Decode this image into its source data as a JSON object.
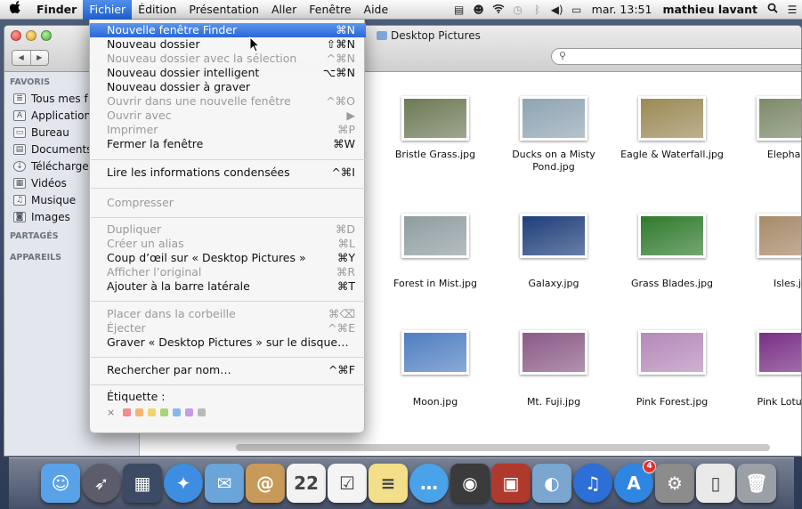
{
  "menubar": {
    "apple_icon": "apple-logo",
    "items": [
      "Finder",
      "Fichier",
      "Édition",
      "Présentation",
      "Aller",
      "Fenêtre",
      "Aide"
    ],
    "active_index": 1,
    "status_icons": [
      "script-icon",
      "finder-extra-icon",
      "wifi-icon",
      "time-machine-icon",
      "bluetooth-icon",
      "volume-icon",
      "battery-icon"
    ],
    "clock": "mar. 13:51",
    "user": "mathieu lavant",
    "spotlight_icon": "magnifier-icon"
  },
  "window": {
    "title": "Desktop Pictures",
    "search_placeholder": ""
  },
  "sidebar": {
    "favorites_header": "FAVORIS",
    "favorites": [
      {
        "label": "Tous mes f",
        "icon": "all-files-icon"
      },
      {
        "label": "Application",
        "icon": "applications-icon"
      },
      {
        "label": "Bureau",
        "icon": "desktop-icon"
      },
      {
        "label": "Documents",
        "icon": "documents-icon"
      },
      {
        "label": "Télécharge",
        "icon": "downloads-icon"
      },
      {
        "label": "Vidéos",
        "icon": "movies-icon"
      },
      {
        "label": "Musique",
        "icon": "music-icon"
      },
      {
        "label": "Images",
        "icon": "pictures-icon"
      }
    ],
    "shared_header": "PARTAGÉS",
    "devices_header": "APPAREILS"
  },
  "files": [
    {
      "name": "Bristle Grass.jpg",
      "color": "#6d7a55"
    },
    {
      "name": "Ducks on a Misty Pond.jpg",
      "color": "#8fa4b3"
    },
    {
      "name": "Eagle & Waterfall.jpg",
      "color": "#9b8a55"
    },
    {
      "name": "Elephant.",
      "color": "#7d8a6a"
    },
    {
      "name": "Forest in Mist.jpg",
      "color": "#8f9da0"
    },
    {
      "name": "Galaxy.jpg",
      "color": "#1e3e7a"
    },
    {
      "name": "Grass Blades.jpg",
      "color": "#2f7a2c"
    },
    {
      "name": "Isles.jp",
      "color": "#a88a6a"
    },
    {
      "name": "Moon.jpg",
      "color": "#4f7ec2"
    },
    {
      "name": "Mt. Fuji.jpg",
      "color": "#8a5a86"
    },
    {
      "name": "Pink Forest.jpg",
      "color": "#b48ab8"
    },
    {
      "name": "Pink Lotus Flc",
      "color": "#7a2f86"
    }
  ],
  "menu": {
    "items": [
      {
        "label": "Nouvelle fenêtre Finder",
        "shortcut": "⌘N",
        "state": "highlighted"
      },
      {
        "label": "Nouveau dossier",
        "shortcut": "⇧⌘N",
        "state": "enabled"
      },
      {
        "label": "Nouveau dossier avec la sélection",
        "shortcut": "^⌘N",
        "state": "disabled"
      },
      {
        "label": "Nouveau dossier intelligent",
        "shortcut": "⌥⌘N",
        "state": "enabled"
      },
      {
        "label": "Nouveau dossier à graver",
        "shortcut": "",
        "state": "enabled"
      },
      {
        "label": "Ouvrir dans une nouvelle fenêtre",
        "shortcut": "^⌘O",
        "state": "disabled"
      },
      {
        "label": "Ouvrir avec",
        "shortcut": "▶",
        "state": "disabled"
      },
      {
        "label": "Imprimer",
        "shortcut": "⌘P",
        "state": "disabled"
      },
      {
        "label": "Fermer la fenêtre",
        "shortcut": "⌘W",
        "state": "enabled"
      },
      {
        "label": "Lire les informations condensées",
        "shortcut": "^⌘I",
        "state": "enabled"
      },
      {
        "label": "Compresser",
        "shortcut": "",
        "state": "disabled"
      },
      {
        "label": "Dupliquer",
        "shortcut": "⌘D",
        "state": "disabled"
      },
      {
        "label": "Créer un alias",
        "shortcut": "⌘L",
        "state": "disabled"
      },
      {
        "label": "Coup d’œil sur « Desktop Pictures »",
        "shortcut": "⌘Y",
        "state": "enabled"
      },
      {
        "label": "Afficher l’original",
        "shortcut": "⌘R",
        "state": "disabled"
      },
      {
        "label": "Ajouter à la barre latérale",
        "shortcut": "⌘T",
        "state": "enabled"
      },
      {
        "label": "Placer dans la corbeille",
        "shortcut": "⌘⌫",
        "state": "disabled"
      },
      {
        "label": "Éjecter",
        "shortcut": "^⌘E",
        "state": "disabled"
      },
      {
        "label": "Graver « Desktop Pictures » sur le disque…",
        "shortcut": "",
        "state": "enabled"
      },
      {
        "label": "Rechercher par nom…",
        "shortcut": "^⌘F",
        "state": "enabled"
      },
      {
        "label": "Étiquette :",
        "shortcut": "",
        "state": "enabled"
      }
    ],
    "tag_clear": "×",
    "tag_colors": [
      "#f28b8b",
      "#f5b36e",
      "#efd56a",
      "#a7d67a",
      "#8ab6ea",
      "#c79be6",
      "#b9b9b9"
    ]
  },
  "dock": {
    "apps": [
      {
        "name": "finder-icon",
        "color": "#5aa2e8",
        "glyph": "☺"
      },
      {
        "name": "launchpad-icon",
        "color": "#5c5c6a",
        "glyph": "➶"
      },
      {
        "name": "mission-control-icon",
        "color": "#3d4a63",
        "glyph": "▦"
      },
      {
        "name": "safari-icon",
        "color": "#3d8ee0",
        "glyph": "✦"
      },
      {
        "name": "mail-icon",
        "color": "#6aa4d8",
        "glyph": "✉"
      },
      {
        "name": "contacts-icon",
        "color": "#c89a5a",
        "glyph": "@"
      },
      {
        "name": "calendar-icon",
        "color": "#f2f2f2",
        "glyph": "22"
      },
      {
        "name": "reminders-icon",
        "color": "#f4f4f4",
        "glyph": "☑"
      },
      {
        "name": "notes-icon",
        "color": "#f3df8a",
        "glyph": "≡"
      },
      {
        "name": "messages-icon",
        "color": "#4aa3e8",
        "glyph": "…"
      },
      {
        "name": "facetime-icon",
        "color": "#3b3b3b",
        "glyph": "◉"
      },
      {
        "name": "photo-booth-icon",
        "color": "#b0392e",
        "glyph": "▣"
      },
      {
        "name": "iphoto-icon",
        "color": "#7aa6d0",
        "glyph": "◐"
      },
      {
        "name": "itunes-icon",
        "color": "#2d6fd6",
        "glyph": "♫"
      },
      {
        "name": "app-store-icon",
        "color": "#2f86e0",
        "glyph": "A",
        "badge": "4"
      },
      {
        "name": "system-preferences-icon",
        "color": "#8c8c8c",
        "glyph": "⚙"
      },
      {
        "name": "document-icon",
        "color": "#e9e9e9",
        "glyph": "▯"
      },
      {
        "name": "trash-icon",
        "color": "#9aa0a6",
        "glyph": "🗑"
      }
    ]
  }
}
